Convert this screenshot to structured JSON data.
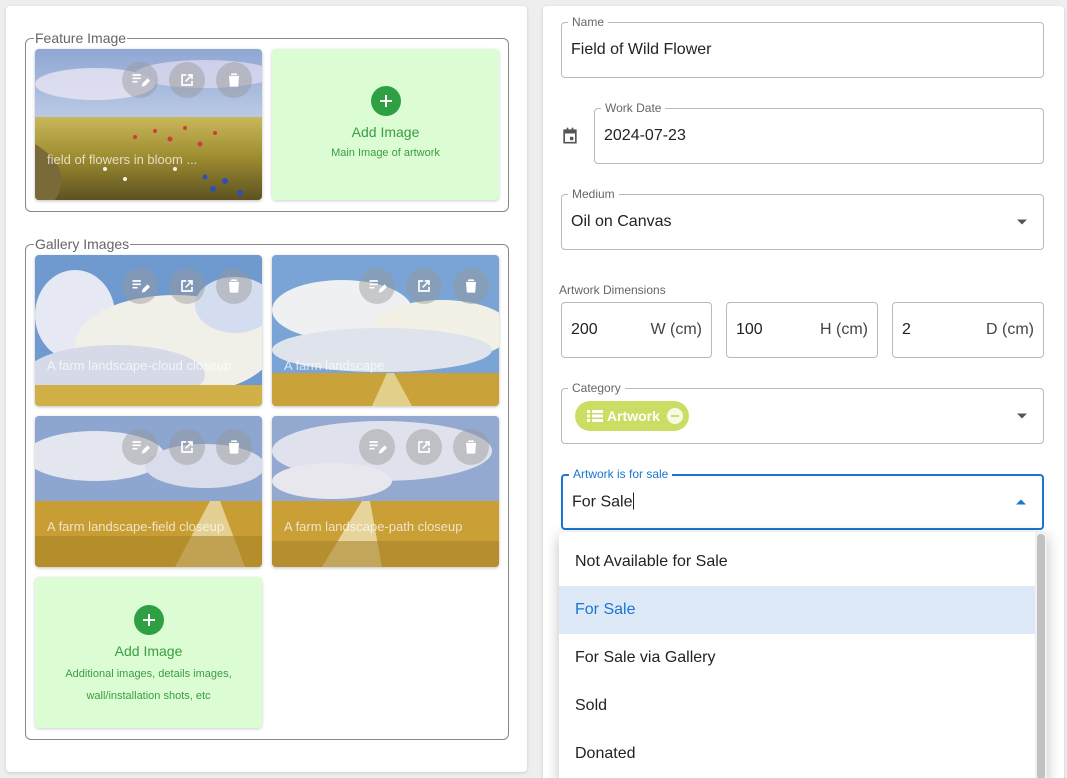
{
  "feature": {
    "legend": "Feature Image",
    "image_caption": "field of flowers in bloom ...",
    "add_title": "Add Image",
    "add_sub": "Main Image of artwork"
  },
  "gallery": {
    "legend": "Gallery Images",
    "items": [
      {
        "caption": "A farm landscape-cloud closeup"
      },
      {
        "caption": "A farm landscape"
      },
      {
        "caption": "A farm landscape-field closeup"
      },
      {
        "caption": "A farm landscape-path closeup"
      }
    ],
    "add_title": "Add Image",
    "add_sub": "Additional images, details images, wall/installation shots, etc"
  },
  "icons": {
    "edit": "edit-note-icon",
    "open": "open-in-new-icon",
    "delete": "delete-icon",
    "add": "add-circle-icon",
    "calendar": "calendar-icon"
  },
  "form": {
    "name": {
      "label": "Name",
      "value": "Field of Wild Flower"
    },
    "work_date": {
      "label": "Work Date",
      "value": "2024-07-23"
    },
    "medium": {
      "label": "Medium",
      "value": "Oil on Canvas"
    },
    "dimensions": {
      "label": "Artwork Dimensions",
      "w": {
        "value": "200",
        "unit": "W (cm)"
      },
      "h": {
        "value": "100",
        "unit": "H (cm)"
      },
      "d": {
        "value": "2",
        "unit": "D (cm)"
      }
    },
    "category": {
      "label": "Category",
      "chip": "Artwork"
    },
    "for_sale": {
      "label": "Artwork is for sale",
      "value": "For Sale"
    }
  },
  "sale_options": [
    "Not Available for Sale",
    "For Sale",
    "For Sale via Gallery",
    "Sold",
    "Donated"
  ],
  "sale_selected": "For Sale",
  "colors": {
    "accent": "#1976d2",
    "add_tile_bg": "#dcfcd4",
    "add_green": "#2ea043",
    "chip": "#cbdd63"
  }
}
